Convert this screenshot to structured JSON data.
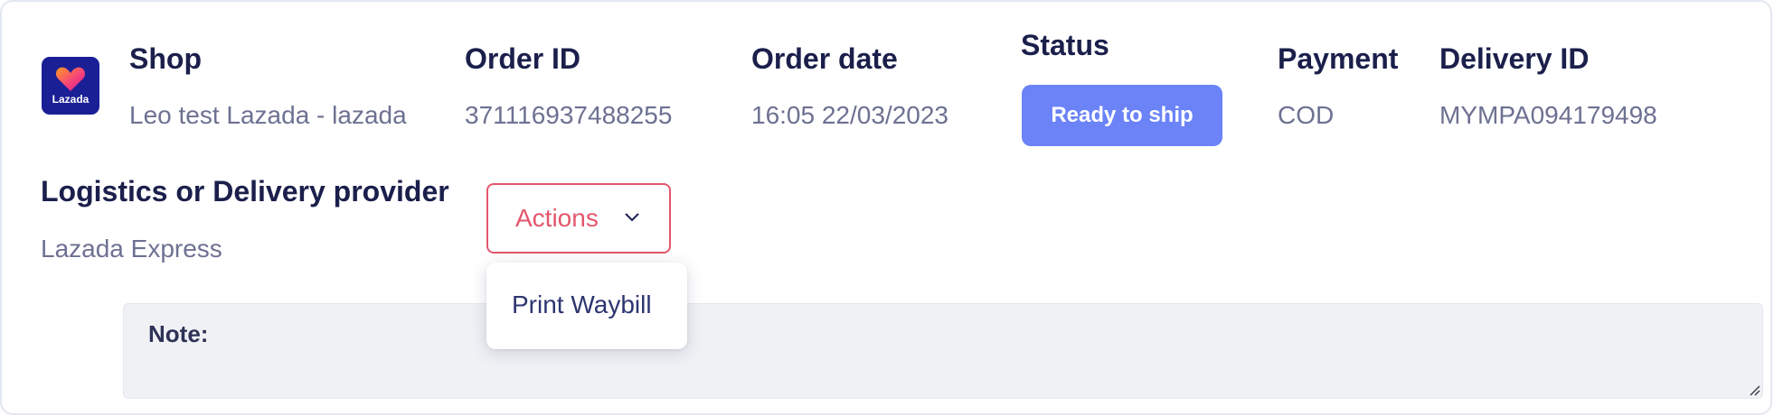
{
  "logo": {
    "text": "Lazada"
  },
  "order": {
    "shop_label": "Shop",
    "shop_value": "Leo test Lazada - lazada",
    "order_id_label": "Order ID",
    "order_id_value": "371116937488255",
    "order_date_label": "Order date",
    "order_date_value": "16:05 22/03/2023",
    "status_label": "Status",
    "status_value": "Ready to ship",
    "payment_label": "Payment",
    "payment_value": "COD",
    "delivery_id_label": "Delivery ID",
    "delivery_id_value": "MYMPA094179498"
  },
  "logistics": {
    "label": "Logistics or Delivery provider",
    "value": "Lazada Express"
  },
  "actions": {
    "label": "Actions",
    "menu_items": [
      "Print Waybill"
    ]
  },
  "note": {
    "label": "Note:"
  },
  "colors": {
    "status_badge": "#6b83f7",
    "actions_accent": "#e3576d",
    "logo_bg": "#1a1f96"
  }
}
